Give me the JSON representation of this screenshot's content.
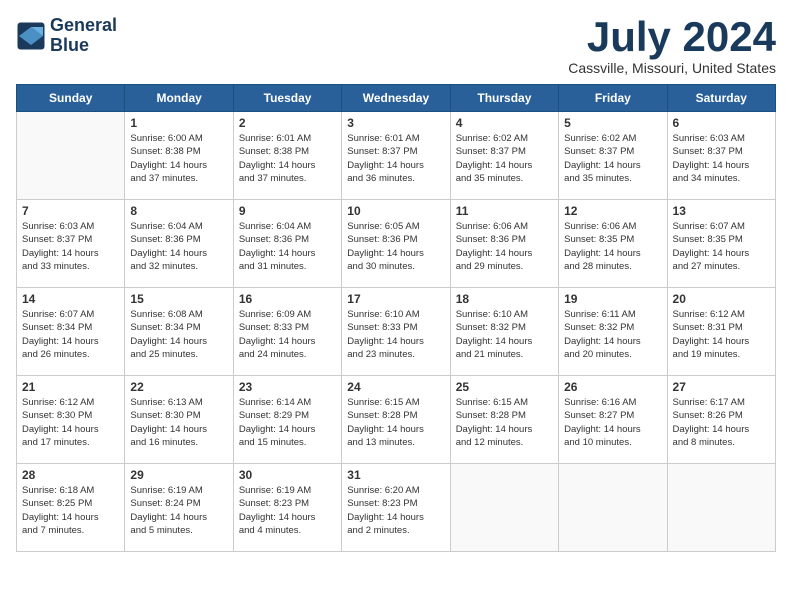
{
  "header": {
    "logo_line1": "General",
    "logo_line2": "Blue",
    "title": "July 2024",
    "location": "Cassville, Missouri, United States"
  },
  "days_of_week": [
    "Sunday",
    "Monday",
    "Tuesday",
    "Wednesday",
    "Thursday",
    "Friday",
    "Saturday"
  ],
  "weeks": [
    [
      {
        "day": "",
        "info": ""
      },
      {
        "day": "1",
        "info": "Sunrise: 6:00 AM\nSunset: 8:38 PM\nDaylight: 14 hours\nand 37 minutes."
      },
      {
        "day": "2",
        "info": "Sunrise: 6:01 AM\nSunset: 8:38 PM\nDaylight: 14 hours\nand 37 minutes."
      },
      {
        "day": "3",
        "info": "Sunrise: 6:01 AM\nSunset: 8:37 PM\nDaylight: 14 hours\nand 36 minutes."
      },
      {
        "day": "4",
        "info": "Sunrise: 6:02 AM\nSunset: 8:37 PM\nDaylight: 14 hours\nand 35 minutes."
      },
      {
        "day": "5",
        "info": "Sunrise: 6:02 AM\nSunset: 8:37 PM\nDaylight: 14 hours\nand 35 minutes."
      },
      {
        "day": "6",
        "info": "Sunrise: 6:03 AM\nSunset: 8:37 PM\nDaylight: 14 hours\nand 34 minutes."
      }
    ],
    [
      {
        "day": "7",
        "info": "Sunrise: 6:03 AM\nSunset: 8:37 PM\nDaylight: 14 hours\nand 33 minutes."
      },
      {
        "day": "8",
        "info": "Sunrise: 6:04 AM\nSunset: 8:36 PM\nDaylight: 14 hours\nand 32 minutes."
      },
      {
        "day": "9",
        "info": "Sunrise: 6:04 AM\nSunset: 8:36 PM\nDaylight: 14 hours\nand 31 minutes."
      },
      {
        "day": "10",
        "info": "Sunrise: 6:05 AM\nSunset: 8:36 PM\nDaylight: 14 hours\nand 30 minutes."
      },
      {
        "day": "11",
        "info": "Sunrise: 6:06 AM\nSunset: 8:36 PM\nDaylight: 14 hours\nand 29 minutes."
      },
      {
        "day": "12",
        "info": "Sunrise: 6:06 AM\nSunset: 8:35 PM\nDaylight: 14 hours\nand 28 minutes."
      },
      {
        "day": "13",
        "info": "Sunrise: 6:07 AM\nSunset: 8:35 PM\nDaylight: 14 hours\nand 27 minutes."
      }
    ],
    [
      {
        "day": "14",
        "info": "Sunrise: 6:07 AM\nSunset: 8:34 PM\nDaylight: 14 hours\nand 26 minutes."
      },
      {
        "day": "15",
        "info": "Sunrise: 6:08 AM\nSunset: 8:34 PM\nDaylight: 14 hours\nand 25 minutes."
      },
      {
        "day": "16",
        "info": "Sunrise: 6:09 AM\nSunset: 8:33 PM\nDaylight: 14 hours\nand 24 minutes."
      },
      {
        "day": "17",
        "info": "Sunrise: 6:10 AM\nSunset: 8:33 PM\nDaylight: 14 hours\nand 23 minutes."
      },
      {
        "day": "18",
        "info": "Sunrise: 6:10 AM\nSunset: 8:32 PM\nDaylight: 14 hours\nand 21 minutes."
      },
      {
        "day": "19",
        "info": "Sunrise: 6:11 AM\nSunset: 8:32 PM\nDaylight: 14 hours\nand 20 minutes."
      },
      {
        "day": "20",
        "info": "Sunrise: 6:12 AM\nSunset: 8:31 PM\nDaylight: 14 hours\nand 19 minutes."
      }
    ],
    [
      {
        "day": "21",
        "info": "Sunrise: 6:12 AM\nSunset: 8:30 PM\nDaylight: 14 hours\nand 17 minutes."
      },
      {
        "day": "22",
        "info": "Sunrise: 6:13 AM\nSunset: 8:30 PM\nDaylight: 14 hours\nand 16 minutes."
      },
      {
        "day": "23",
        "info": "Sunrise: 6:14 AM\nSunset: 8:29 PM\nDaylight: 14 hours\nand 15 minutes."
      },
      {
        "day": "24",
        "info": "Sunrise: 6:15 AM\nSunset: 8:28 PM\nDaylight: 14 hours\nand 13 minutes."
      },
      {
        "day": "25",
        "info": "Sunrise: 6:15 AM\nSunset: 8:28 PM\nDaylight: 14 hours\nand 12 minutes."
      },
      {
        "day": "26",
        "info": "Sunrise: 6:16 AM\nSunset: 8:27 PM\nDaylight: 14 hours\nand 10 minutes."
      },
      {
        "day": "27",
        "info": "Sunrise: 6:17 AM\nSunset: 8:26 PM\nDaylight: 14 hours\nand 8 minutes."
      }
    ],
    [
      {
        "day": "28",
        "info": "Sunrise: 6:18 AM\nSunset: 8:25 PM\nDaylight: 14 hours\nand 7 minutes."
      },
      {
        "day": "29",
        "info": "Sunrise: 6:19 AM\nSunset: 8:24 PM\nDaylight: 14 hours\nand 5 minutes."
      },
      {
        "day": "30",
        "info": "Sunrise: 6:19 AM\nSunset: 8:23 PM\nDaylight: 14 hours\nand 4 minutes."
      },
      {
        "day": "31",
        "info": "Sunrise: 6:20 AM\nSunset: 8:23 PM\nDaylight: 14 hours\nand 2 minutes."
      },
      {
        "day": "",
        "info": ""
      },
      {
        "day": "",
        "info": ""
      },
      {
        "day": "",
        "info": ""
      }
    ]
  ]
}
